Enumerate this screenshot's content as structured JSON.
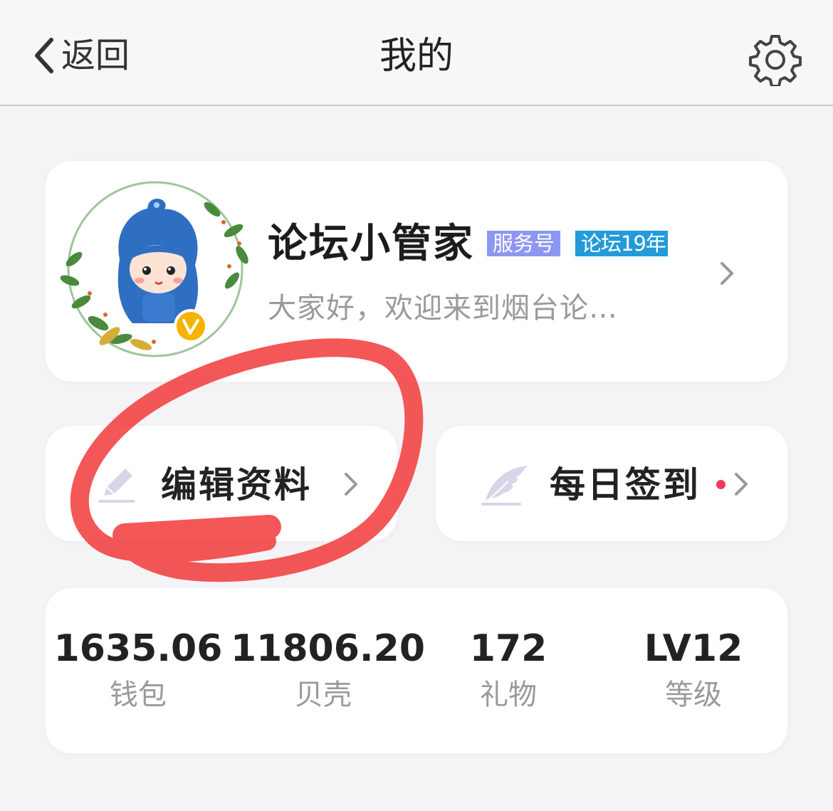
{
  "nav": {
    "back_label": "返回",
    "title": "我的",
    "settings_icon": "gear-icon"
  },
  "profile": {
    "name": "论坛小管家",
    "badges": [
      "服务号",
      "论坛19年"
    ],
    "bio": "大家好，欢迎来到烟台论…",
    "colors": {
      "badge_service": "#8d97f0",
      "badge_years": "#229bd9",
      "verified": "#f4b400"
    }
  },
  "actions": {
    "edit_label": "编辑资料",
    "sign_label": "每日签到",
    "edit_icon": "pencil-icon",
    "sign_icon": "feather-icon",
    "notification_color": "#f2375d"
  },
  "stats": [
    {
      "value": "1635.06",
      "label": "钱包"
    },
    {
      "value": "11806.20",
      "label": "贝壳"
    },
    {
      "value": "172",
      "label": "礼物"
    },
    {
      "value": "LV12",
      "label": "等级"
    }
  ],
  "annotation": {
    "color": "#f23a3a",
    "shape": "freehand-circle"
  }
}
